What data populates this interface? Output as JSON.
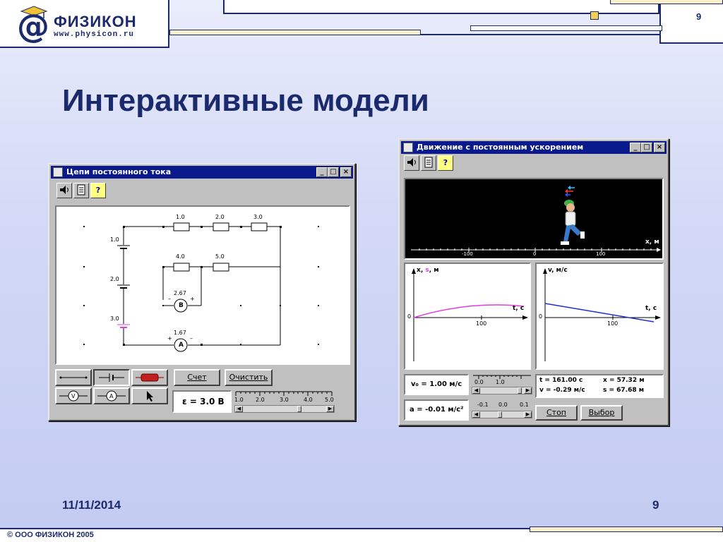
{
  "header": {
    "logo_symbol": "@",
    "logo_name": "ФИЗИКОН",
    "logo_url": "www.physicon.ru",
    "slide_number": "9"
  },
  "title": "Интерактивные модели",
  "footer": {
    "date": "11/11/2014",
    "slide_number": "9",
    "copyright": "© ООО ФИЗИКОН 2005"
  },
  "colors": {
    "brand": "#1b2a6c",
    "accent_yellow": "#f1d14d",
    "titlebar": "#0a1a8c",
    "magenta_series": "#e23ee2",
    "blue_series": "#2030c8"
  },
  "window_circuit": {
    "title": "Цепи постоянного тока",
    "toolbar_icons": [
      "speaker-icon",
      "document-icon",
      "help-icon"
    ],
    "help_label": "?",
    "resistor_labels": [
      "1.0",
      "2.0",
      "3.0",
      "4.0",
      "5.0"
    ],
    "battery_labels": [
      "1.0",
      "2.0",
      "3.0"
    ],
    "voltmeter_value": "2.67",
    "voltmeter_symbol": "B",
    "ammeter_value": "1.67",
    "ammeter_symbol": "A",
    "palette_tools": [
      "wire-tool-icon",
      "battery-tool-icon",
      "resistor-tool-icon",
      "voltmeter-tool-icon",
      "ammeter-tool-icon",
      "pointer-tool-icon"
    ],
    "count_button": "Счет",
    "clear_button": "Очистить",
    "emf_readout": "ε = 3.0 B",
    "emf_scale_labels": [
      "1.0",
      "2.0",
      "3.0",
      "4.0",
      "5.0"
    ],
    "emf_value": 3.0
  },
  "window_motion": {
    "title": "Движение с постоянным ускорением",
    "help_label": "?",
    "track_axis_label": "x, м",
    "track_ticks": [
      "-100",
      "0",
      "100"
    ],
    "graph_left": {
      "ylabel_x": "x",
      "ylabel_s": "s",
      "ylabel_unit": ", м",
      "xlabel": "t, с",
      "origin": "0",
      "tick": "100"
    },
    "graph_right": {
      "ylabel": "v, м/с",
      "xlabel": "t, с",
      "origin": "0",
      "tick": "100"
    },
    "v0_readout": "v₀ = 1.00 м/с",
    "a_readout": "a = -0.01 м/с²",
    "v0_scale": [
      "0.0",
      "1.0"
    ],
    "a_scale": [
      "-0.1",
      "0.0",
      "0.1"
    ],
    "t_readout": "t = 161.00 с",
    "x_readout": "x = 57.32 м",
    "v_readout": "v = -0.29 м/с",
    "s_readout": "s = 67.68 м",
    "stop_button": "Стоп",
    "select_button": "Выбор"
  }
}
